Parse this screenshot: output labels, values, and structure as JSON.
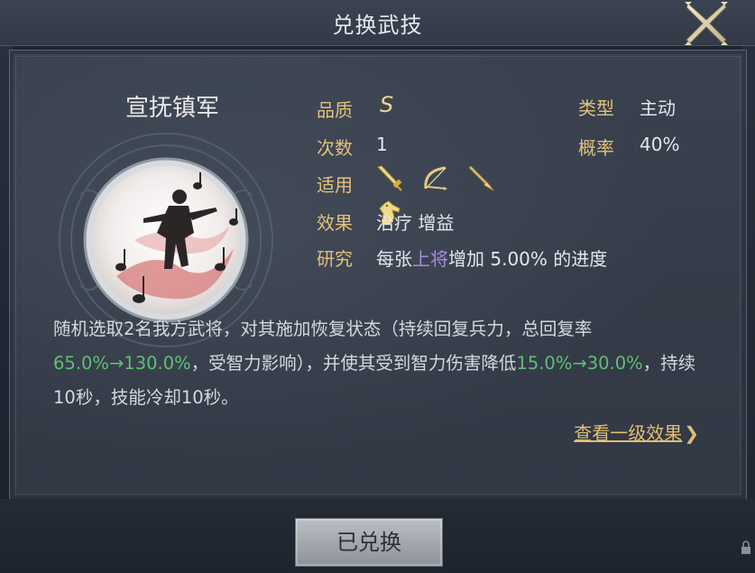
{
  "header": {
    "title": "兑换武技",
    "close_icon": "close-x-icon"
  },
  "skill": {
    "name": "宣抚镇军",
    "emblem_icon": "musician-dancer-icon",
    "stats": {
      "quality_label": "品质",
      "quality_value": "S",
      "type_label": "类型",
      "type_value": "主动",
      "count_label": "次数",
      "count_value": "1",
      "chance_label": "概率",
      "chance_value": "40%",
      "applicable_label": "适用",
      "applicable_icons": [
        "sword-icon",
        "bow-icon",
        "spear-icon",
        "horse-icon"
      ],
      "effect_label": "效果",
      "effect_value": "治疗 增益",
      "research_label": "研究",
      "research_prefix": "每张",
      "research_highlight": "上将",
      "research_suffix": "增加 5.00% 的进度"
    },
    "description": {
      "part1": "随机选取2名我方武将，对其施加恢复状态（持续回复兵力，总回复率",
      "num1": "65.0%→130.0%",
      "part2": "，受智力影响），并使其受到智力伤害降低",
      "num2": "15.0%→30.0%",
      "part3": "，持续10秒，技能冷却10秒。"
    },
    "level1_link": "查看一级效果",
    "level1_chevron": "❯"
  },
  "footer": {
    "redeem_button": "已兑换"
  },
  "colors": {
    "gold": "#e2c27a",
    "green": "#5fbf75",
    "purple": "#a78be0"
  }
}
